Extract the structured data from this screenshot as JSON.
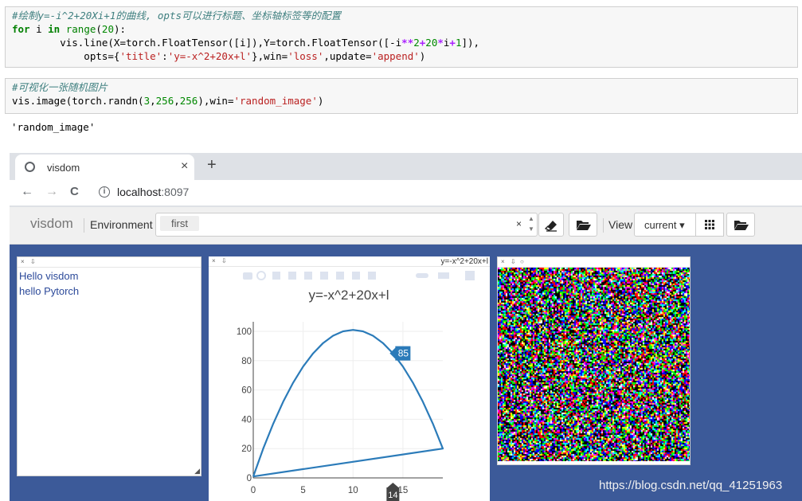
{
  "cells": [
    {
      "lines": [
        [
          {
            "c": "cm",
            "t": "#绘制y=-i^2+20Xi+1的曲线, opts可以进行标题、坐标轴标签等的配置"
          }
        ],
        [
          {
            "c": "kw",
            "t": "for"
          },
          {
            "c": "",
            "t": " i "
          },
          {
            "c": "kw",
            "t": "in"
          },
          {
            "c": "",
            "t": " "
          },
          {
            "c": "bi",
            "t": "range"
          },
          {
            "c": "",
            "t": "("
          },
          {
            "c": "num",
            "t": "20"
          },
          {
            "c": "",
            "t": "):"
          }
        ],
        [
          {
            "c": "",
            "t": "        vis.line(X=torch.FloatTensor([i]),Y=torch.FloatTensor([-i"
          },
          {
            "c": "op",
            "t": "**"
          },
          {
            "c": "num",
            "t": "2"
          },
          {
            "c": "op",
            "t": "+"
          },
          {
            "c": "num",
            "t": "20"
          },
          {
            "c": "op",
            "t": "*"
          },
          {
            "c": "",
            "t": "i"
          },
          {
            "c": "op",
            "t": "+"
          },
          {
            "c": "num",
            "t": "1"
          },
          {
            "c": "",
            "t": "]),"
          }
        ],
        [
          {
            "c": "",
            "t": "            opts={"
          },
          {
            "c": "str",
            "t": "'title'"
          },
          {
            "c": "",
            "t": ":"
          },
          {
            "c": "str",
            "t": "'y=-x^2+20x+l'"
          },
          {
            "c": "",
            "t": "},win="
          },
          {
            "c": "str",
            "t": "'loss'"
          },
          {
            "c": "",
            "t": ",update="
          },
          {
            "c": "str",
            "t": "'append'"
          },
          {
            "c": "",
            "t": ")"
          }
        ]
      ]
    },
    {
      "lines": [
        [
          {
            "c": "cm",
            "t": "#可视化一张随机图片"
          }
        ],
        [
          {
            "c": "",
            "t": "vis.image(torch.randn("
          },
          {
            "c": "num",
            "t": "3"
          },
          {
            "c": "",
            "t": ","
          },
          {
            "c": "num",
            "t": "256"
          },
          {
            "c": "",
            "t": ","
          },
          {
            "c": "num",
            "t": "256"
          },
          {
            "c": "",
            "t": "),win="
          },
          {
            "c": "str",
            "t": "'random_image'"
          },
          {
            "c": "",
            "t": ")"
          }
        ]
      ]
    }
  ],
  "output_text": "'random_image'",
  "browser": {
    "tab_title": "visdom",
    "tab_close": "×",
    "new_tab": "+",
    "url_host": "localhost",
    "url_port": ":8097",
    "nav_back": "←",
    "nav_forward": "→",
    "nav_reload": "C",
    "info": "i"
  },
  "visdom": {
    "brand": "visdom",
    "env_label": "Environment",
    "env_tag": "first",
    "env_clear": "×",
    "view_label": "View",
    "view_value": "current ▾"
  },
  "text_pane": {
    "bar_close": "×",
    "bar_save": "⇩",
    "lines": [
      "Hello visdom",
      "hello Pytorch"
    ]
  },
  "plot_pane": {
    "bar_close": "×",
    "bar_save": "⇩",
    "title_tab": "y=-x^2+20x+l",
    "title": "y=-x^2+20x+l",
    "hover_y_label": "85",
    "hover_x_label": "14"
  },
  "image_pane": {
    "bar_close": "×",
    "bar_save": "⇩",
    "bar_reset": "○"
  },
  "watermark": "https://blog.csdn.net/qq_41251963",
  "chart_data": {
    "type": "line",
    "title": "y=-x^2+20x+l",
    "xlim": [
      0,
      19
    ],
    "ylim": [
      0,
      100
    ],
    "xticks": [
      0,
      5,
      10,
      15
    ],
    "yticks": [
      0,
      20,
      40,
      60,
      80,
      100
    ],
    "x": [
      0,
      1,
      2,
      3,
      4,
      5,
      6,
      7,
      8,
      9,
      10,
      11,
      12,
      13,
      14,
      15,
      16,
      17,
      18,
      19,
      0
    ],
    "y": [
      1,
      20,
      37,
      52,
      65,
      76,
      85,
      92,
      97,
      100,
      101,
      100,
      97,
      92,
      85,
      76,
      65,
      52,
      37,
      20,
      1
    ],
    "hover_point": [
      14,
      85
    ]
  }
}
